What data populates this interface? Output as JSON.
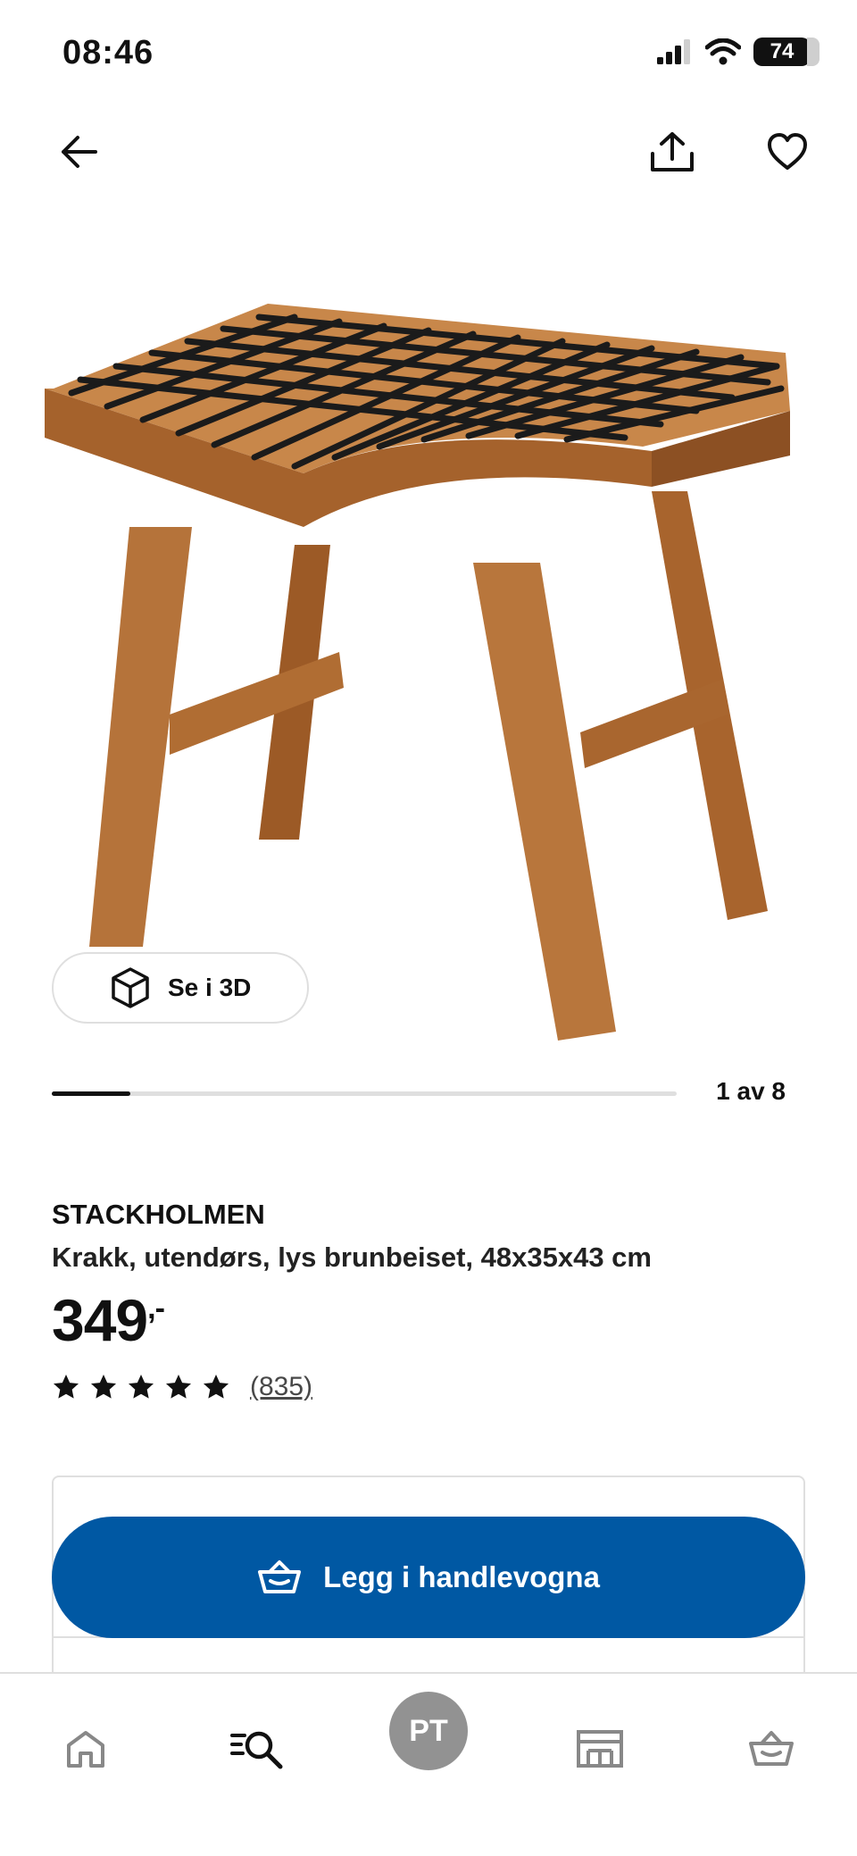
{
  "status_bar": {
    "time": "08:46",
    "battery": "74",
    "icons": [
      "cellular-signal-icon",
      "wifi-icon",
      "battery-icon"
    ]
  },
  "top_nav": {
    "icons": [
      "back-arrow-icon",
      "share-icon",
      "heart-icon"
    ]
  },
  "gallery": {
    "view_3d_label": "Se i 3D",
    "view_3d_icon": "cube-icon",
    "counter": "1 av 8",
    "current_image": 1,
    "total_images": 8,
    "progress_fraction": 0.125
  },
  "product": {
    "name": "STACKHOLMEN",
    "description": "Krakk, utendørs, lys brunbeiset, 48x35x43 cm",
    "price": "349",
    "price_suffix": ",-",
    "rating_stars": 5,
    "rating_count": "(835)"
  },
  "actions": {
    "add_to_cart_label": "Legg i handlevogna",
    "add_to_cart_icon": "basket-icon",
    "accent_color": "#0058a3"
  },
  "bottom_nav": {
    "items": [
      {
        "icon": "home-icon"
      },
      {
        "icon": "search-icon"
      },
      {
        "avatar_initials": "PT"
      },
      {
        "icon": "store-icon"
      },
      {
        "icon": "basket-icon"
      }
    ]
  }
}
